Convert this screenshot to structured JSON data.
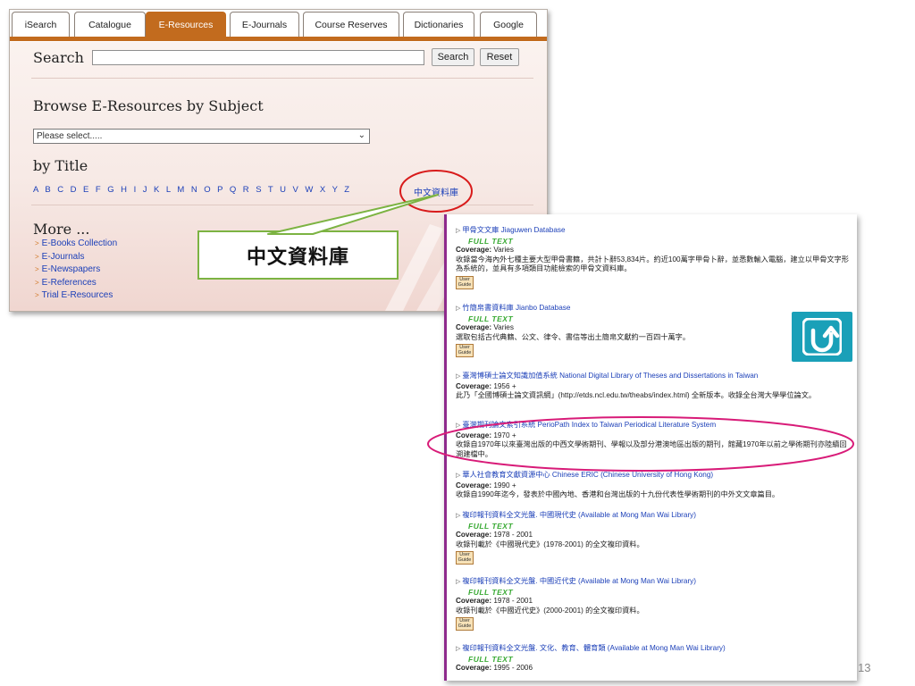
{
  "tabs": [
    {
      "label": "iSearch"
    },
    {
      "label": "Catalogue"
    },
    {
      "label": "E-Resources"
    },
    {
      "label": "E-Journals"
    },
    {
      "label": "Course Reserves"
    },
    {
      "label": "Dictionaries"
    },
    {
      "label": "Google"
    }
  ],
  "active_tab": "E-Resources",
  "search": {
    "label": "Search",
    "value": "",
    "search_button": "Search",
    "reset_button": "Reset"
  },
  "browse": {
    "heading": "Browse E-Resources by Subject",
    "select_value": "Please select....."
  },
  "by_title": {
    "heading": "by Title",
    "letters": "A B C D E F G H I J K L M N O P Q R S T U V W X Y Z",
    "chinese_link": "中文資料庫"
  },
  "more": {
    "heading": "More ...",
    "items": [
      "E-Books Collection",
      "E-Journals",
      "E-Newspapers",
      "E-References",
      "Trial E-Resources"
    ]
  },
  "callout": {
    "text": "中文資料庫"
  },
  "results": [
    {
      "title": "甲骨文文庫 Jiaguwen Database",
      "full_text": "FULL TEXT",
      "coverage_label": "Coverage:",
      "coverage": "Varies",
      "description": "收錄當今海內外七種主要大型甲骨書籍，共計卜辭53,834片。約近100萬字甲骨卜辭，並悉數輸入電腦，建立以甲骨文字形為系統的，並具有多項類目功能檢索的甲骨文資料庫。",
      "guide": "User Guide"
    },
    {
      "title": "竹簡帛書資料庫 Jianbo Database",
      "full_text": "FULL TEXT",
      "coverage_label": "Coverage:",
      "coverage": "Varies",
      "description": "選取包括古代典籍、公文、律令、書信等出土簡帛文獻約一百四十萬字。",
      "guide": "User Guide"
    },
    {
      "title": "臺灣博碩士論文知識加值系統 National Digital Library of Theses and Dissertations in Taiwan",
      "coverage_label": "Coverage:",
      "coverage": "1956 +",
      "description": "此乃「全國博碩士論文資訊網」(http://etds.ncl.edu.tw/theabs/index.html) 全新版本。收錄全台灣大學學位論文。"
    },
    {
      "title": "臺灣期刊論文索引系統 PerioPath Index to Taiwan Periodical Literature System",
      "coverage_label": "Coverage:",
      "coverage": "1970 +",
      "description": "收錄自1970年以來臺灣出版的中西文學術期刊、學報以及部分港澳地區出版的期刊，館藏1970年以前之學術期刊亦陸續回溯建檔中。"
    },
    {
      "title": "華人社會教育文獻資源中心 Chinese ERIC (Chinese University of Hong Kong)",
      "coverage_label": "Coverage:",
      "coverage": "1990 +",
      "description": "收錄自1990年迄今，發表於中國內地、香港和台灣出版的十九份代表性學術期刊的中外文文章篇目。"
    },
    {
      "title": "複印報刊資料全文光盤. 中國現代史 (Available at Mong Man Wai Library)",
      "full_text": "FULL TEXT",
      "coverage_label": "Coverage:",
      "coverage": "1978 - 2001",
      "description": "收錄刊載於《中國現代史》(1978-2001) 的全文複印資料。",
      "guide": "User Guide"
    },
    {
      "title": "複印報刊資料全文光盤. 中國近代史 (Available at Mong Man Wai Library)",
      "full_text": "FULL TEXT",
      "coverage_label": "Coverage:",
      "coverage": "1978 - 2001",
      "description": "收錄刊載於《中國近代史》(2000-2001) 的全文複印資料。",
      "guide": "User Guide"
    },
    {
      "title": "複印報刊資料全文光盤. 文化、教育、體育類 (Available at Mong Man Wai Library)",
      "full_text": "FULL TEXT",
      "coverage_label": "Coverage:",
      "coverage": "1995 - 2006"
    }
  ],
  "page_number": "13",
  "colors": {
    "accent": "#c26b1e",
    "link": "#1b3fb8",
    "full_text": "#3aaa35",
    "highlight_red": "#d81b1b",
    "highlight_magenta": "#d81b78",
    "callout_green": "#7cb342",
    "upload_button": "#1aa0b8"
  },
  "icons": {
    "upload": "upload-arrow-icon",
    "bullet": "triangle-bullet-icon",
    "guide": "user-guide-icon"
  }
}
